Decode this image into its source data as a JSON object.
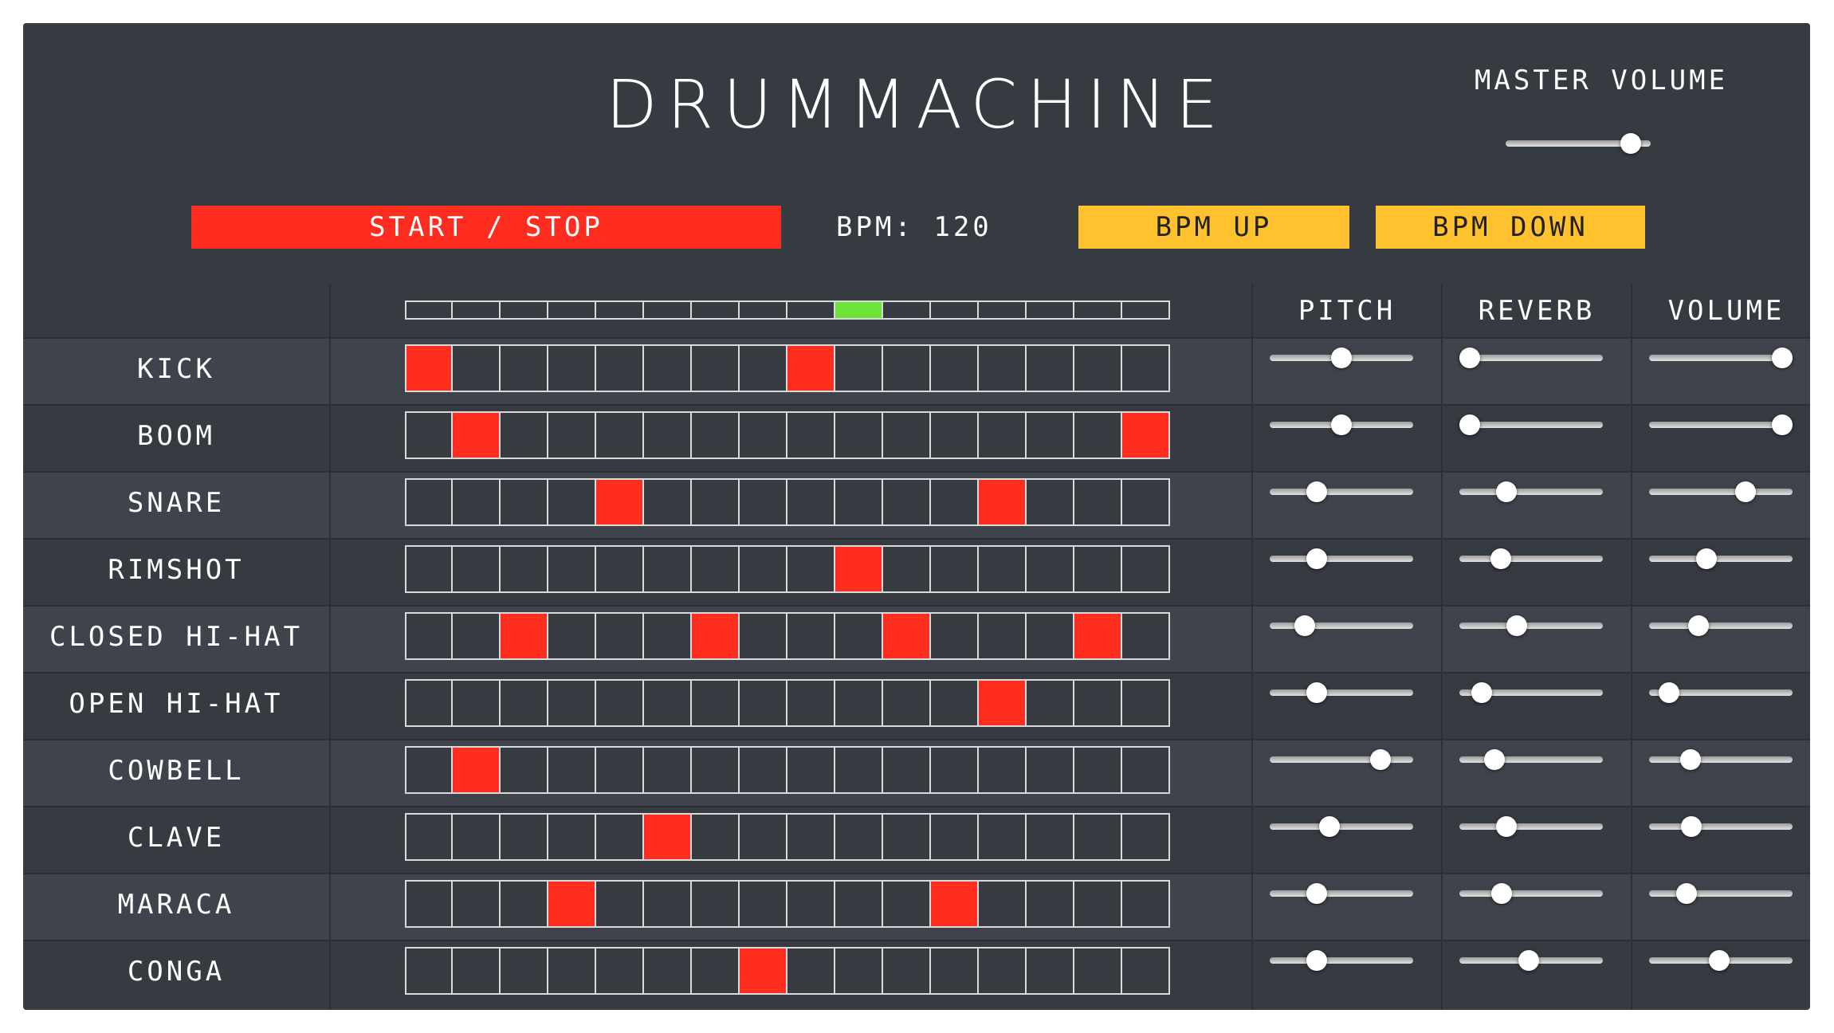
{
  "app": {
    "title": "DRUMMACHINE",
    "master_volume_label": "MASTER VOLUME",
    "master_volume": 0.92,
    "start_stop_label": "START / STOP",
    "bpm_display": "BPM: 120",
    "bpm_up_label": "BPM UP",
    "bpm_down_label": "BPM DOWN",
    "accent_color": "#ff2d1f",
    "bpm_button_color": "#ffc12e",
    "playhead_color": "#6ee33a"
  },
  "grid": {
    "columns": {
      "pitch": "PITCH",
      "reverb": "REVERB",
      "volume": "VOLUME"
    },
    "step_count": 16,
    "current_step": 10,
    "instruments": [
      {
        "name": "KICK",
        "steps": [
          1,
          0,
          0,
          0,
          0,
          0,
          0,
          0,
          1,
          0,
          0,
          0,
          0,
          0,
          0,
          0
        ],
        "pitch": 0.5,
        "reverb": 0.0,
        "volume": 1.0
      },
      {
        "name": "BOOM",
        "steps": [
          0,
          1,
          0,
          0,
          0,
          0,
          0,
          0,
          0,
          0,
          0,
          0,
          0,
          0,
          0,
          1
        ],
        "pitch": 0.5,
        "reverb": 0.0,
        "volume": 1.0
      },
      {
        "name": "SNARE",
        "steps": [
          0,
          0,
          0,
          0,
          1,
          0,
          0,
          0,
          0,
          0,
          0,
          0,
          1,
          0,
          0,
          0
        ],
        "pitch": 0.3,
        "reverb": 0.3,
        "volume": 0.7
      },
      {
        "name": "RIMSHOT",
        "steps": [
          0,
          0,
          0,
          0,
          0,
          0,
          0,
          0,
          0,
          1,
          0,
          0,
          0,
          0,
          0,
          0
        ],
        "pitch": 0.3,
        "reverb": 0.25,
        "volume": 0.38
      },
      {
        "name": "CLOSED HI-HAT",
        "steps": [
          0,
          0,
          1,
          0,
          0,
          0,
          1,
          0,
          0,
          0,
          1,
          0,
          0,
          0,
          1,
          0
        ],
        "pitch": 0.2,
        "reverb": 0.38,
        "volume": 0.32
      },
      {
        "name": "OPEN HI-HAT",
        "steps": [
          0,
          0,
          0,
          0,
          0,
          0,
          0,
          0,
          0,
          0,
          0,
          0,
          1,
          0,
          0,
          0
        ],
        "pitch": 0.3,
        "reverb": 0.1,
        "volume": 0.08
      },
      {
        "name": "COWBELL",
        "steps": [
          0,
          1,
          0,
          0,
          0,
          0,
          0,
          0,
          0,
          0,
          0,
          0,
          0,
          0,
          0,
          0
        ],
        "pitch": 0.82,
        "reverb": 0.2,
        "volume": 0.25
      },
      {
        "name": "CLAVE",
        "steps": [
          0,
          0,
          0,
          0,
          0,
          1,
          0,
          0,
          0,
          0,
          0,
          0,
          0,
          0,
          0,
          0
        ],
        "pitch": 0.4,
        "reverb": 0.3,
        "volume": 0.26
      },
      {
        "name": "MARACA",
        "steps": [
          0,
          0,
          0,
          1,
          0,
          0,
          0,
          0,
          0,
          0,
          0,
          1,
          0,
          0,
          0,
          0
        ],
        "pitch": 0.3,
        "reverb": 0.26,
        "volume": 0.22
      },
      {
        "name": "CONGA",
        "steps": [
          0,
          0,
          0,
          0,
          0,
          0,
          0,
          1,
          0,
          0,
          0,
          0,
          0,
          0,
          0,
          0
        ],
        "pitch": 0.3,
        "reverb": 0.48,
        "volume": 0.49
      }
    ]
  }
}
